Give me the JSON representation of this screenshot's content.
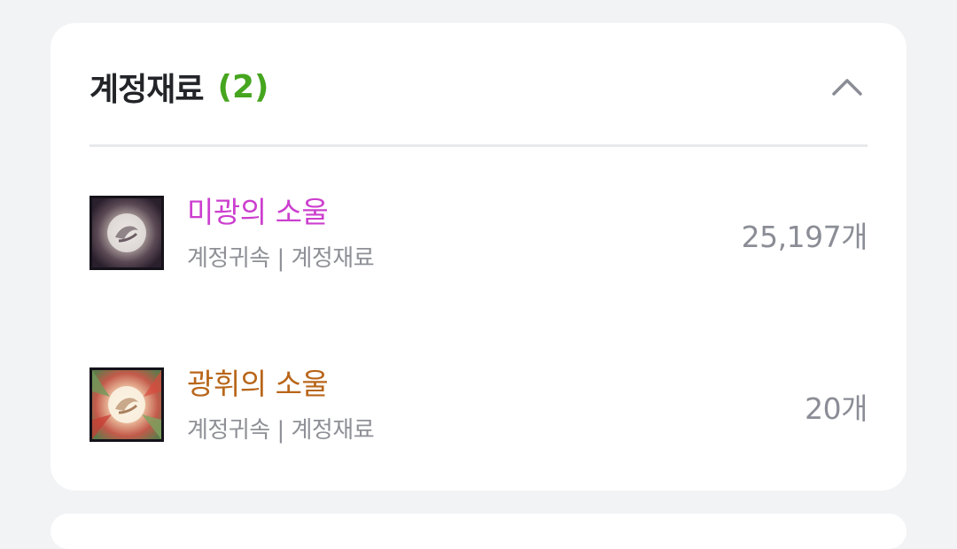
{
  "section": {
    "title": "계정재료",
    "count": "(2)",
    "collapse_icon": "chevron-up-icon"
  },
  "colors": {
    "count_green": "#46a51f",
    "item1_name": "#cc3fcf",
    "item2_name": "#b8661a",
    "muted": "#8e9096"
  },
  "items": [
    {
      "name": "미광의 소울",
      "tags": "계정귀속 | 계정재료",
      "quantity": "25,197개",
      "icon": "soul-orb-icon"
    },
    {
      "name": "광휘의 소울",
      "tags": "계정귀속 | 계정재료",
      "quantity": "20개",
      "icon": "radiant-soul-orb-icon"
    }
  ]
}
